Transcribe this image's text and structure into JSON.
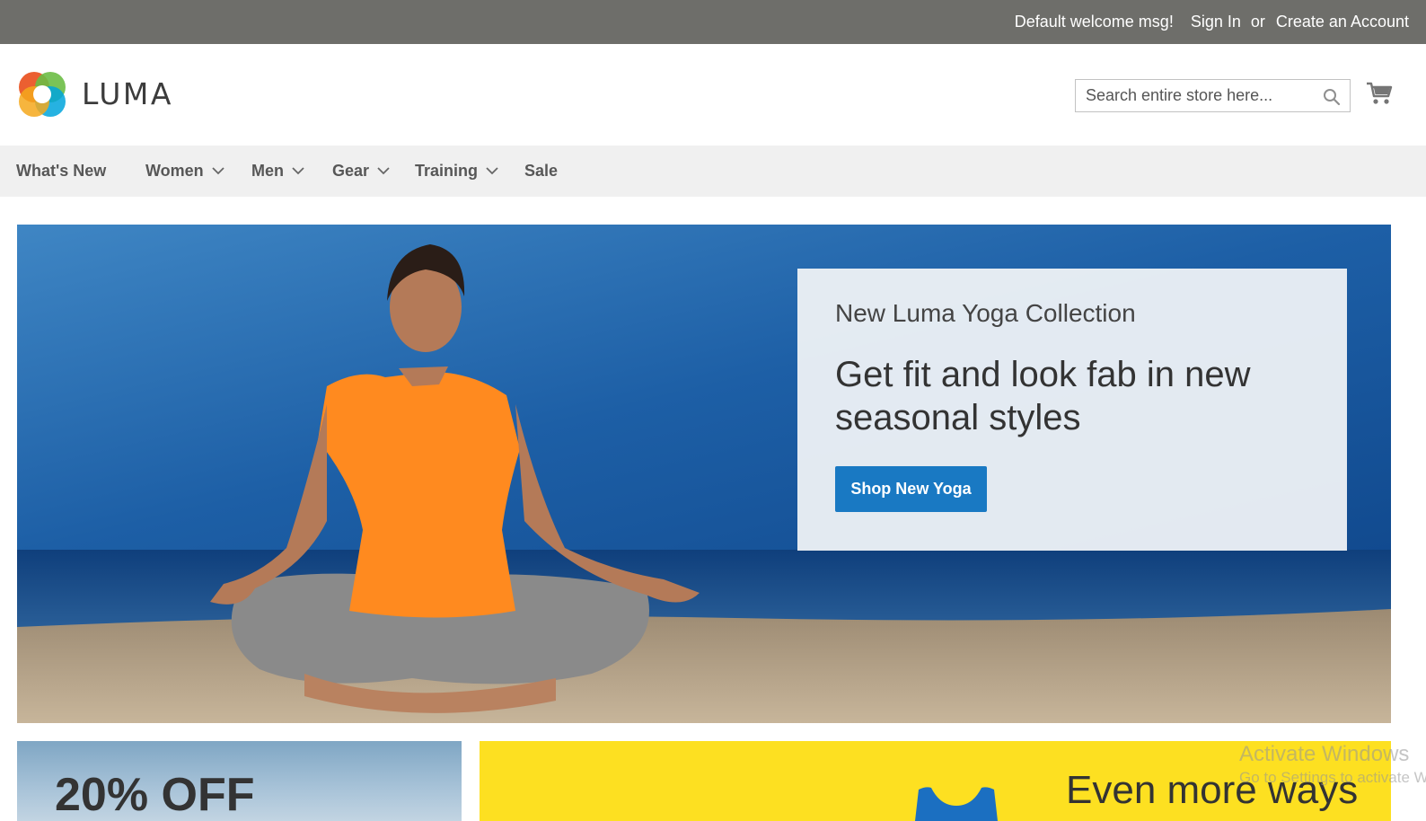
{
  "topbar": {
    "welcome": "Default welcome msg!",
    "sign_in": "Sign In",
    "or": "or",
    "create_account": "Create an Account"
  },
  "header": {
    "logo_text": "LUMA",
    "search_placeholder": "Search entire store here...",
    "search_icon": "search-icon",
    "cart_icon": "cart-icon"
  },
  "nav": {
    "items": [
      {
        "label": "What's New",
        "dropdown": false
      },
      {
        "label": "Women",
        "dropdown": true
      },
      {
        "label": "Men",
        "dropdown": true
      },
      {
        "label": "Gear",
        "dropdown": true
      },
      {
        "label": "Training",
        "dropdown": true
      },
      {
        "label": "Sale",
        "dropdown": false
      }
    ]
  },
  "hero": {
    "subtitle": "New Luma Yoga Collection",
    "headline": "Get fit and look fab in new seasonal styles",
    "button": "Shop New Yoga"
  },
  "tiles": {
    "left_title": "20% OFF",
    "right_title": "Even more ways"
  },
  "watermark": {
    "line1": "Activate Windows",
    "line2": "Go to Settings to activate Windows."
  },
  "colors": {
    "topbar": "#6e6e6a",
    "nav_bg": "#f0f0f0",
    "button": "#1979c3",
    "yellow_tile": "#fde021"
  }
}
